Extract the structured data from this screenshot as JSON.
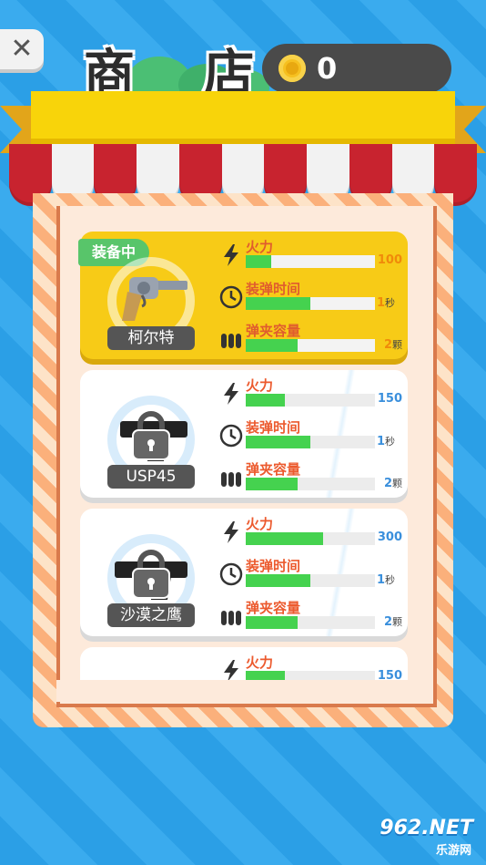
{
  "header": {
    "close_icon": "✕",
    "title": "商 店",
    "coins": "0"
  },
  "weapons": [
    {
      "name": "柯尔特",
      "status": "装备中",
      "equipped": true,
      "locked": false,
      "stats": {
        "firepower": {
          "label": "火力",
          "value": "100",
          "fill": 0.2
        },
        "reload": {
          "label": "装弹时间",
          "value": "1",
          "unit": "秒",
          "fill": 0.5
        },
        "magazine": {
          "label": "弹夹容量",
          "value": "2",
          "unit": "颗",
          "fill": 0.4
        }
      }
    },
    {
      "name": "USP45",
      "equipped": false,
      "locked": true,
      "stats": {
        "firepower": {
          "label": "火力",
          "value": "150",
          "fill": 0.3
        },
        "reload": {
          "label": "装弹时间",
          "value": "1",
          "unit": "秒",
          "fill": 0.5
        },
        "magazine": {
          "label": "弹夹容量",
          "value": "2",
          "unit": "颗",
          "fill": 0.4
        }
      }
    },
    {
      "name": "沙漠之鹰",
      "equipped": false,
      "locked": true,
      "stats": {
        "firepower": {
          "label": "火力",
          "value": "300",
          "fill": 0.6
        },
        "reload": {
          "label": "装弹时间",
          "value": "1",
          "unit": "秒",
          "fill": 0.5
        },
        "magazine": {
          "label": "弹夹容量",
          "value": "2",
          "unit": "颗",
          "fill": 0.4
        }
      }
    },
    {
      "name": "",
      "equipped": false,
      "locked": true,
      "stats": {
        "firepower": {
          "label": "火力",
          "value": "150",
          "fill": 0.3
        }
      }
    }
  ],
  "watermark": {
    "main": "962.NET",
    "sub": "乐游网"
  },
  "colors": {
    "accent_yellow": "#f7cb17",
    "bar_green": "#45d24f",
    "label_orange": "#e05c2e",
    "value_blue": "#3a8fdc"
  }
}
